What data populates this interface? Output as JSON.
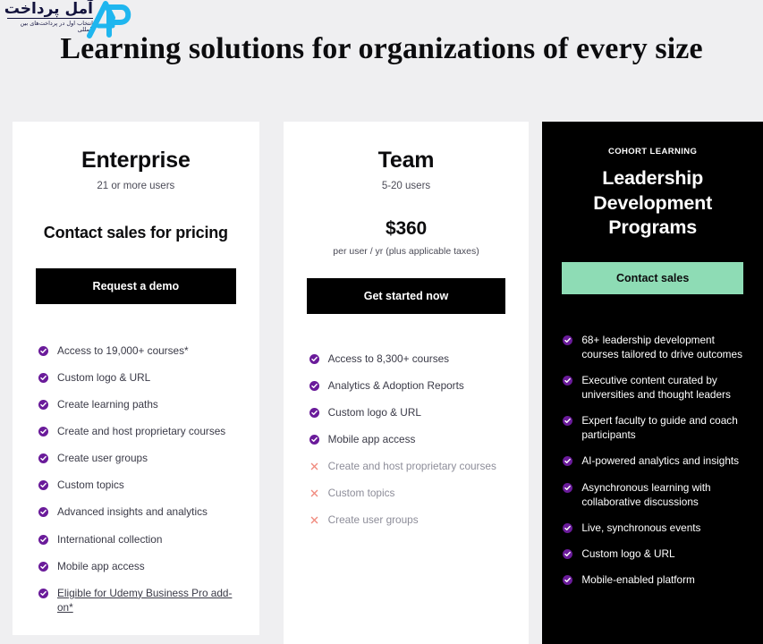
{
  "watermark": {
    "brand_fa": "آمل پرداخت",
    "tagline_fa": "انتخاب اول در پرداخت‌های بین المللی",
    "monogram": "AP",
    "monogram_color": "#29b6f0"
  },
  "heading": "Learning solutions for organizations of every size",
  "colors": {
    "page_background": "#efeff1",
    "card_background": "#ffffff",
    "dark_card_background": "#000000",
    "check_icon": "#6a1b9a",
    "cross_icon": "#f08a7e",
    "mint_button": "#8edcb5",
    "dark_button": "#000000"
  },
  "plans": [
    {
      "name": "Enterprise",
      "users": "21 or more users",
      "price": "Contact sales for pricing",
      "price_note": "",
      "cta_label": "Request a demo",
      "features": [
        {
          "label": "Access to 19,000+ courses*",
          "included": true
        },
        {
          "label": "Custom logo & URL",
          "included": true
        },
        {
          "label": "Create learning paths",
          "included": true
        },
        {
          "label": "Create and host proprietary courses",
          "included": true
        },
        {
          "label": "Create user groups",
          "included": true
        },
        {
          "label": "Custom topics",
          "included": true
        },
        {
          "label": "Advanced insights and analytics",
          "included": true
        },
        {
          "label": "International collection",
          "included": true
        },
        {
          "label": "Mobile app access",
          "included": true
        },
        {
          "label": "Eligible for Udemy Business Pro add-on*",
          "included": true,
          "link": true
        }
      ]
    },
    {
      "name": "Team",
      "users": "5-20 users",
      "price": "$360",
      "price_note": "per user / yr (plus applicable taxes)",
      "cta_label": "Get started now",
      "features": [
        {
          "label": "Access to 8,300+ courses",
          "included": true
        },
        {
          "label": "Analytics & Adoption Reports",
          "included": true
        },
        {
          "label": "Custom logo & URL",
          "included": true
        },
        {
          "label": "Mobile app access",
          "included": true
        },
        {
          "label": "Create and host proprietary courses",
          "included": false
        },
        {
          "label": "Custom topics",
          "included": false
        },
        {
          "label": "Create user groups",
          "included": false
        }
      ]
    }
  ],
  "cohort": {
    "eyebrow": "COHORT LEARNING",
    "title": "Leadership Development Programs",
    "cta_label": "Contact sales",
    "features": [
      {
        "label": "68+ leadership development courses tailored to drive outcomes",
        "included": true
      },
      {
        "label": "Executive content curated by universities and thought leaders",
        "included": true
      },
      {
        "label": "Expert faculty to guide and coach participants",
        "included": true
      },
      {
        "label": "AI-powered analytics and insights",
        "included": true
      },
      {
        "label": "Asynchronous learning with collaborative discussions",
        "included": true
      },
      {
        "label": "Live, synchronous events",
        "included": true
      },
      {
        "label": "Custom logo & URL",
        "included": true
      },
      {
        "label": "Mobile-enabled platform",
        "included": true
      }
    ]
  }
}
